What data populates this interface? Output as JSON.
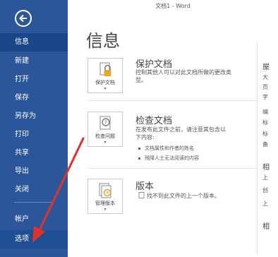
{
  "window": {
    "title": "文档1 - Word"
  },
  "sidebar": {
    "items": [
      {
        "label": "信息"
      },
      {
        "label": "新建"
      },
      {
        "label": "打开"
      },
      {
        "label": "保存"
      },
      {
        "label": "另存为"
      },
      {
        "label": "打印"
      },
      {
        "label": "共享"
      },
      {
        "label": "导出"
      },
      {
        "label": "关闭"
      },
      {
        "label": "帐户"
      },
      {
        "label": "选项"
      }
    ]
  },
  "main": {
    "title": "信息",
    "protect": {
      "tile_label": "保护文档",
      "title": "保护文档",
      "desc_line1": "控制其他人可以对此文档所做的更改类",
      "desc_line2": "型。"
    },
    "inspect": {
      "tile_label": "检查问题",
      "title": "检查文档",
      "desc_line1": "在发布此文件之前，请注意其包含以",
      "desc_line2": "下内容:",
      "bullets": [
        "文档属性和作者的姓名",
        "残障人士无法阅读的内容"
      ]
    },
    "versions": {
      "tile_label": "管理版本",
      "title": "版本",
      "desc": "找不到此文件的上一个版本。"
    }
  },
  "right_panel": {
    "chars": [
      "屋",
      "大",
      "页",
      "字",
      "编",
      "标",
      "标",
      "备",
      "相",
      "上",
      "创",
      "上",
      "相"
    ]
  },
  "colors": {
    "sidebar": "#2b579a",
    "active": "#19478a",
    "arrow": "#e0302a"
  }
}
